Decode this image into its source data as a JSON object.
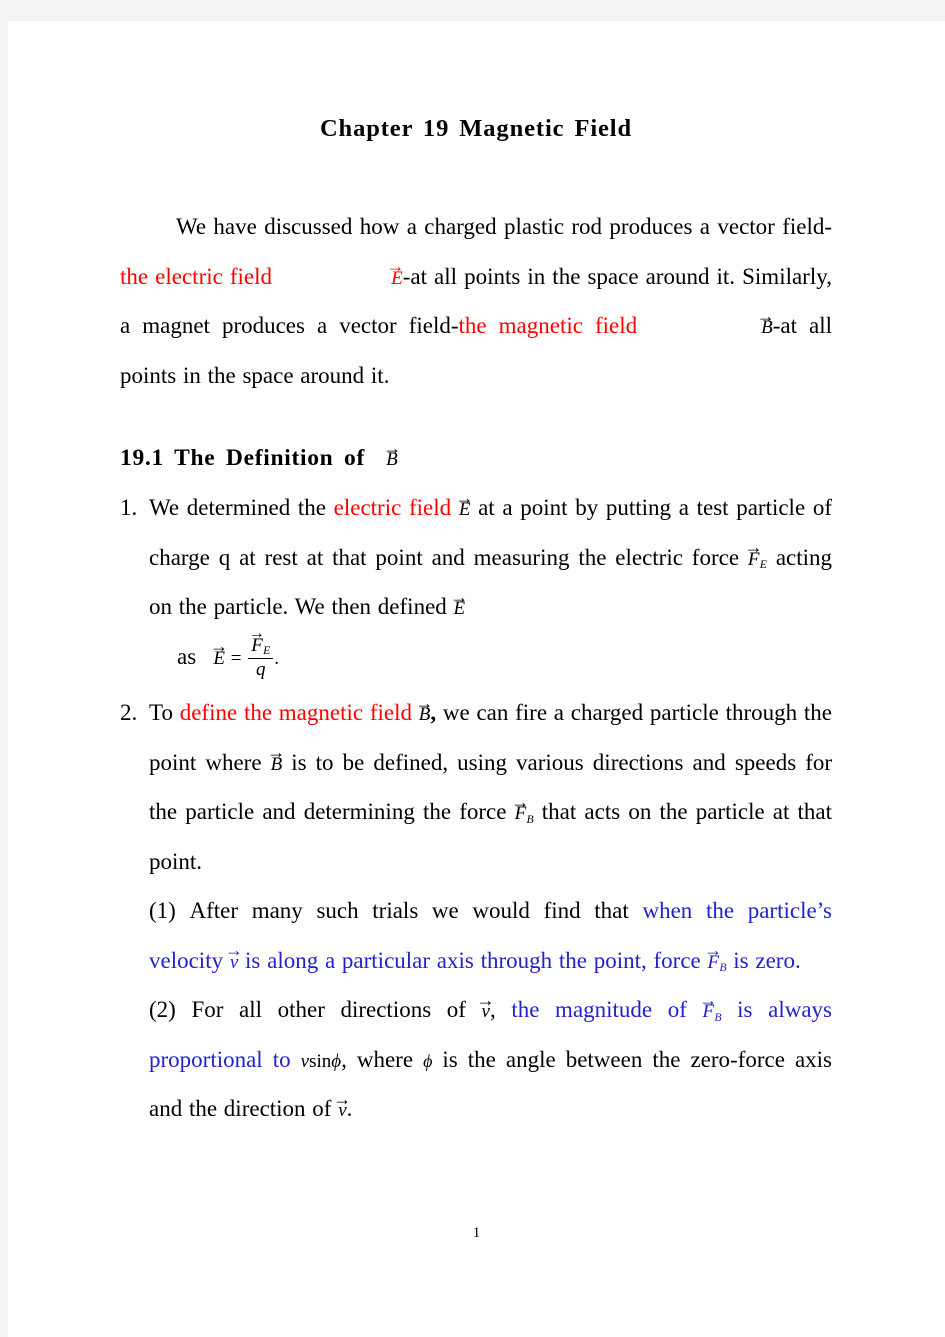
{
  "document": {
    "title": "Chapter 19 Magnetic Field",
    "page_number": "1",
    "colors": {
      "emphasis_red": "#ff0000",
      "emphasis_blue": "#2222cc",
      "text": "#000000",
      "page_background": "#ffffff",
      "canvas_background": "#f4f4f4"
    }
  },
  "intro_paragraph": {
    "seg1": "We have discussed how a charged plastic rod produces a vector field-",
    "seg2_red": "the electric field",
    "sym_E": "E",
    "seg3": "-at all points in the space around it. Similarly, a magnet produces a vector field-",
    "seg4_red": "the magnetic field",
    "sym_B": "B",
    "seg5": "-at all points in the space around it."
  },
  "section": {
    "heading_text": "19.1 The Definition of",
    "heading_symbol": "B"
  },
  "items": [
    {
      "marker": "1.",
      "seg1": "We determined the",
      "seg2_red": "electric field",
      "sym_E": "E",
      "seg3": "at a point by putting a test particle of charge q at rest at that point and measuring the electric force",
      "sym_F_E_base": "F",
      "sym_F_E_sub": "E",
      "seg4": "acting on the particle. We then defined",
      "sym_E2": "E",
      "equation": {
        "lead": "as",
        "lhs": "E",
        "relation": "=",
        "numerator_base": "F",
        "numerator_sub": "E",
        "denominator": "q",
        "trailing": "."
      }
    },
    {
      "marker": "2.",
      "seg1": "To",
      "seg2_red": "define the magnetic field",
      "sym_B": "B",
      "comma": ",",
      "seg3": "we can fire a charged particle through the point where",
      "sym_B2": "B",
      "seg4": "is to be defined, using various directions and speeds for the particle and determining the force",
      "sym_F_B_base": "F",
      "sym_F_B_sub": "B",
      "seg5": "that acts on the particle at that point."
    }
  ],
  "sub_items": [
    {
      "marker": "(1)",
      "seg1": "After many such trials we would find that",
      "seg2_blue": "when the particle’s velocity",
      "sym_v": "v",
      "seg3_blue": "is along a particular axis through the point, force",
      "sym_F_B_base": "F",
      "sym_F_B_sub": "B",
      "seg4_blue": "is zero."
    },
    {
      "marker": "(2)",
      "seg1": "For all other directions of",
      "sym_v": "v",
      "comma": ",",
      "seg2_blue": "the magnitude of",
      "sym_F_B_base": "F",
      "sym_F_B_sub": "B",
      "seg3_blue": "is always proportional to",
      "formula_v": "v",
      "formula_sin": "sin",
      "formula_phi": "ϕ",
      "comma2": ",",
      "seg4": "where",
      "sym_phi": "ϕ",
      "seg5": "is the angle between the zero-force axis and the direction of",
      "sym_v2": "v",
      "period": "."
    }
  ]
}
